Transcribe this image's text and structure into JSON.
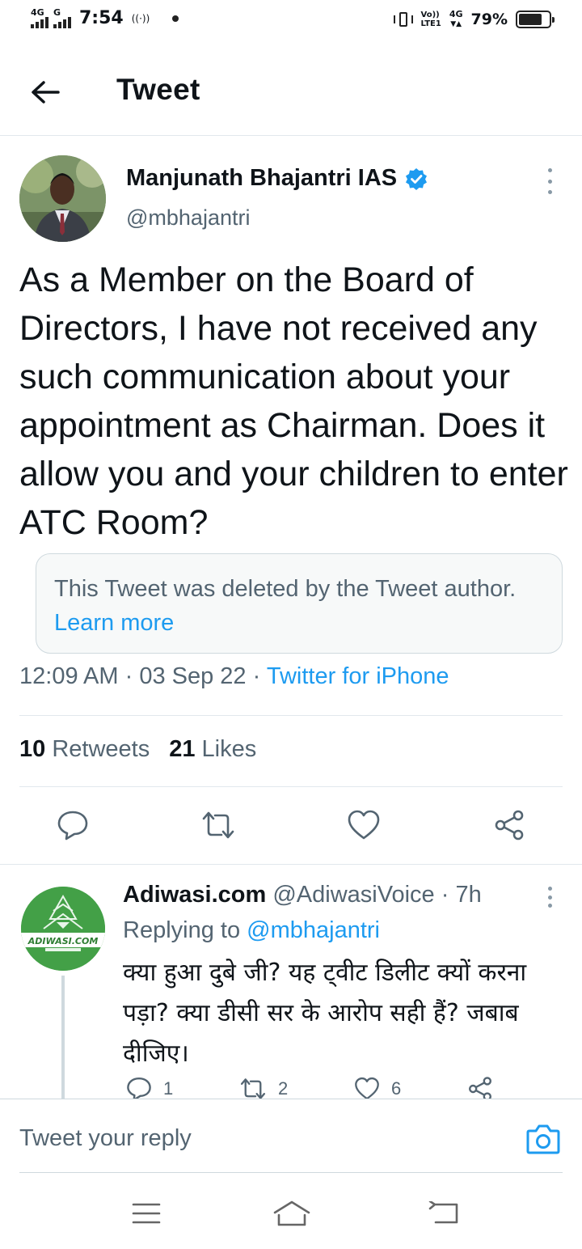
{
  "status_bar": {
    "sim1_label": "4G",
    "sim2_label": "G",
    "time": "7:54",
    "volte_top": "Vo))",
    "volte_bottom": "LTE1",
    "net_label": "4G",
    "battery_percent": "79%",
    "battery_level": 0.79
  },
  "header": {
    "title": "Tweet"
  },
  "tweet": {
    "author_name": "Manjunath Bhajantri IAS",
    "handle": "@mbhajantri",
    "verified": true,
    "text": "As a Member on the Board of Directors, I have not received any such communication about your appointment as Chairman. Does it allow you and your children to enter ATC Room?",
    "deleted_notice": "This Tweet was deleted by the Tweet author.",
    "deleted_link": "Learn more",
    "time": "12:09 AM",
    "date": "03 Sep 22",
    "separator": "·",
    "source": "Twitter for iPhone",
    "retweets_count": "10",
    "retweets_label": "Retweets",
    "likes_count": "21",
    "likes_label": "Likes"
  },
  "reply": {
    "avatar_text": "ADIWASI.COM",
    "author_name": "Adiwasi.com",
    "handle": "@AdiwasiVoice",
    "separator": "·",
    "time": "7h",
    "replying_prefix": "Replying to",
    "replying_to": "@mbhajantri",
    "text": "क्या हुआ दुबे जी? यह ट्वीट डिलीट क्यों करना पड़ा? क्या डीसी सर के आरोप सही हैं? जबाब दीजिए।",
    "reply_count": "1",
    "retweet_count": "2",
    "like_count": "6"
  },
  "composer": {
    "placeholder": "Tweet your reply"
  },
  "colors": {
    "accent": "#1d9bf0",
    "secondary_text": "#536471",
    "divider": "#e1e8ed",
    "reply_avatar_green": "#43a047"
  },
  "icons": {
    "back": "arrow-left-icon",
    "verified": "verified-badge-icon",
    "more": "more-vertical-icon",
    "reply": "comment-icon",
    "retweet": "retweet-icon",
    "like": "heart-icon",
    "share": "share-icon",
    "camera": "camera-icon",
    "nav_menu": "menu-icon",
    "nav_home": "home-icon",
    "nav_back": "back-icon"
  }
}
